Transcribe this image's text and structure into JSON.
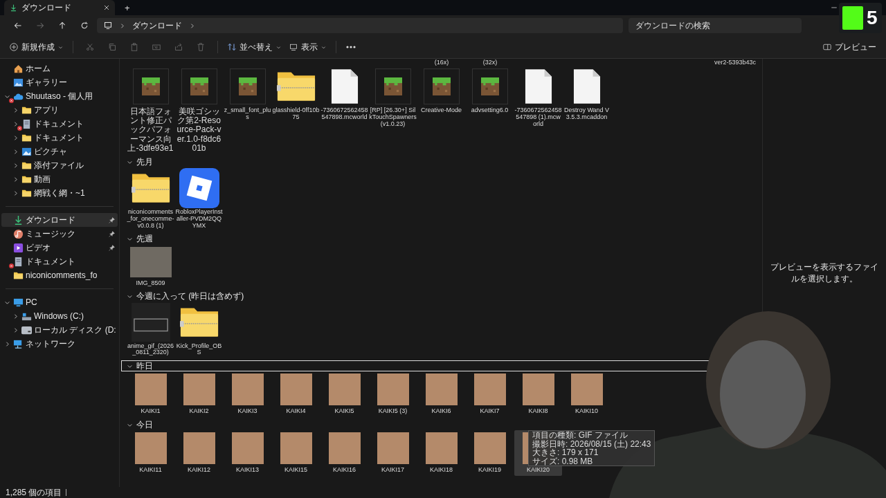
{
  "window": {
    "tab_title": "ダウンロード",
    "new_tab": "+"
  },
  "address": {
    "crumbs": [
      "ダウンロード"
    ],
    "search_placeholder": "ダウンロードの検索"
  },
  "toolbar": {
    "new_label": "新規作成",
    "sort_label": "並べ替え",
    "view_label": "表示",
    "preview_label": "プレビュー"
  },
  "sidebar": {
    "sections": [
      [
        {
          "label": "ホーム",
          "kind": "home",
          "selected": false
        },
        {
          "label": "ギャラリー",
          "kind": "gallery",
          "selected": false
        },
        {
          "label": "Shuutaso - 個人用",
          "kind": "cloud",
          "selected": false,
          "expanded": true,
          "sync_error": true,
          "children": [
            {
              "label": "アプリ",
              "kind": "folder",
              "selected": false,
              "expanded": false
            },
            {
              "label": "ドキュメント",
              "kind": "doc",
              "selected": false,
              "expanded": false,
              "sync_error": true
            },
            {
              "label": "ドキュメント",
              "kind": "folder",
              "selected": false,
              "expanded": false
            },
            {
              "label": "ピクチャ",
              "kind": "picture",
              "selected": false,
              "expanded": false
            },
            {
              "label": "添付ファイル",
              "kind": "folder",
              "selected": false,
              "expanded": false
            },
            {
              "label": "動画",
              "kind": "folder",
              "selected": false,
              "expanded": false
            },
            {
              "label": "網戦く網・~1",
              "kind": "folder",
              "selected": false,
              "expanded": false
            }
          ]
        }
      ],
      [
        {
          "label": "ダウンロード",
          "kind": "download",
          "selected": true,
          "pinned": true
        },
        {
          "label": "ミュージック",
          "kind": "music",
          "selected": false,
          "pinned": true
        },
        {
          "label": "ビデオ",
          "kind": "video",
          "selected": false,
          "pinned": true
        },
        {
          "label": "ドキュメント",
          "kind": "doc",
          "selected": false,
          "sync_error": true
        },
        {
          "label": "niconicomments_fo",
          "kind": "folder",
          "selected": false
        }
      ],
      [
        {
          "label": "PC",
          "kind": "pc",
          "selected": false,
          "expanded": true,
          "children": [
            {
              "label": "Windows (C:)",
              "kind": "windrive",
              "selected": false,
              "expanded": false
            },
            {
              "label": "ローカル ディスク (D:",
              "kind": "drive",
              "selected": false,
              "expanded": false
            }
          ]
        },
        {
          "label": "ネットワーク",
          "kind": "network",
          "selected": false,
          "expanded": false
        }
      ]
    ]
  },
  "groups": [
    {
      "edge_fragment": "ver2-5393b43c",
      "items": [
        {
          "name": "日本語フォント修正パックパフォーマンス向上-3dfe93e1",
          "kind": "block",
          "selected": false
        },
        {
          "name": "美咲ゴシック第2-Resource-Pack-ver.1.0-f8dc601b",
          "kind": "block",
          "selected": false
        },
        {
          "name": "z_small_font_plus",
          "kind": "block",
          "selected": false
        },
        {
          "name": "glasshield-0ff10b75",
          "kind": "zip",
          "selected": false
        },
        {
          "name": "-7360672562458547898.mcworld",
          "kind": "file",
          "selected": false
        },
        {
          "name": "[RP] [26.30+] SilkTouchSpawners (v1.0.23)",
          "kind": "block",
          "selected": false
        },
        {
          "name": "Creative-Mode",
          "kind": "block",
          "selected": false,
          "cut_caption": "(16x)"
        },
        {
          "name": "advsetting6.0",
          "kind": "block",
          "selected": false,
          "cut_caption": "(32x)"
        },
        {
          "name": "-7360672562458547898 (1).mcworld",
          "kind": "file",
          "selected": false
        },
        {
          "name": "Destroy Wand V3.5.3.mcaddon",
          "kind": "file",
          "selected": false
        }
      ]
    },
    {
      "title": "先月",
      "expanded": true,
      "focused": false,
      "items": [
        {
          "name": "niconicomments_for_onecomme-v0.0.8 (1)",
          "kind": "zip",
          "selected": false
        },
        {
          "name": "RobloxPlayerInstaller-PVDM2QQYMX",
          "kind": "app",
          "selected": false
        }
      ]
    },
    {
      "title": "先週",
      "expanded": true,
      "focused": false,
      "items": [
        {
          "name": "IMG_8509",
          "kind": "photo",
          "selected": false
        }
      ]
    },
    {
      "title": "今週に入って (昨日は含めず)",
      "expanded": true,
      "focused": false,
      "items": [
        {
          "name": "anime_gif_(2026_0811_2320)",
          "kind": "video",
          "selected": false
        },
        {
          "name": "Kick_Profile_OBS",
          "kind": "zip",
          "selected": false
        }
      ]
    },
    {
      "title": "昨日",
      "expanded": true,
      "focused": true,
      "items": [
        {
          "name": "KAIKI1",
          "kind": "face",
          "selected": false
        },
        {
          "name": "KAIKI2",
          "kind": "face",
          "selected": false
        },
        {
          "name": "KAIKI3",
          "kind": "face",
          "selected": false
        },
        {
          "name": "KAIKI4",
          "kind": "face",
          "selected": false
        },
        {
          "name": "KAIKI5",
          "kind": "face",
          "selected": false
        },
        {
          "name": "KAIKI5 (3)",
          "kind": "face",
          "selected": false
        },
        {
          "name": "KAIKI6",
          "kind": "face",
          "selected": false
        },
        {
          "name": "KAIKI7",
          "kind": "face",
          "selected": false
        },
        {
          "name": "KAIKI8",
          "kind": "face",
          "selected": false
        },
        {
          "name": "KAIKI10",
          "kind": "face",
          "selected": false
        }
      ]
    },
    {
      "title": "今日",
      "expanded": true,
      "focused": false,
      "items": [
        {
          "name": "KAIKI11",
          "kind": "face",
          "selected": false
        },
        {
          "name": "KAIKI12",
          "kind": "face",
          "selected": false
        },
        {
          "name": "KAIKI13",
          "kind": "face",
          "selected": false
        },
        {
          "name": "KAIKI15",
          "kind": "face",
          "selected": false
        },
        {
          "name": "KAIKI16",
          "kind": "face",
          "selected": false
        },
        {
          "name": "KAIKI17",
          "kind": "face",
          "selected": false
        },
        {
          "name": "KAIKI18",
          "kind": "face",
          "selected": false
        },
        {
          "name": "KAIKI19",
          "kind": "face",
          "selected": false
        },
        {
          "name": "KAIKI20",
          "kind": "face",
          "selected": true
        }
      ]
    }
  ],
  "tooltip": {
    "lines": [
      "項目の種類: GIF ファイル",
      "撮影日時: 2026/08/15 (土) 22:43",
      "大きさ: 179 x 171",
      "サイズ: 0.98 MB"
    ]
  },
  "preview_pane": {
    "message": "プレビューを表示するファイルを選択します。"
  },
  "status_bar": {
    "count": "1,285 個の項目"
  },
  "stream_badge": {
    "count": "5"
  }
}
